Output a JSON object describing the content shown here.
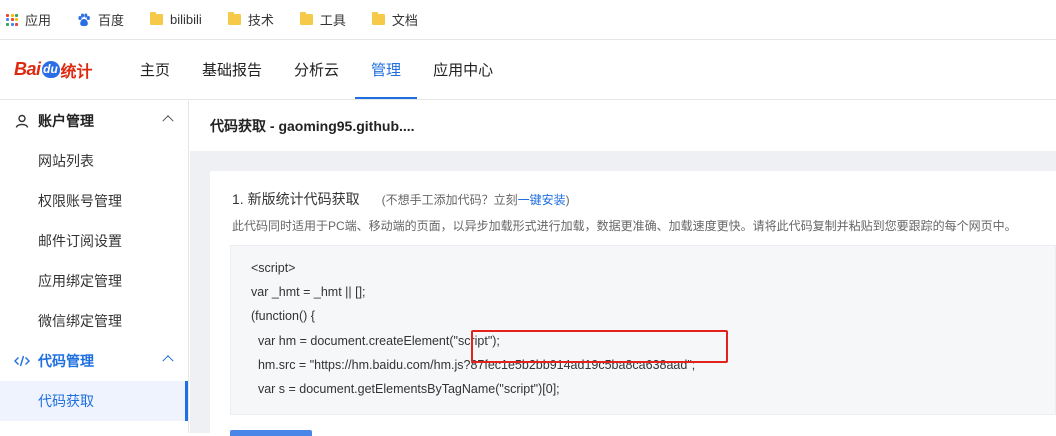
{
  "bookmarks": [
    {
      "label": "应用",
      "icon": "apps-grid-icon"
    },
    {
      "label": "百度",
      "icon": "baidu-paw-icon"
    },
    {
      "label": "bilibili",
      "icon": "folder-icon"
    },
    {
      "label": "技术",
      "icon": "folder-icon"
    },
    {
      "label": "工具",
      "icon": "folder-icon"
    },
    {
      "label": "文档",
      "icon": "folder-icon"
    }
  ],
  "logo": {
    "bai": "Bai",
    "du": "du",
    "tongji": "统计"
  },
  "nav": {
    "items": [
      {
        "label": "主页",
        "active": false
      },
      {
        "label": "基础报告",
        "active": false
      },
      {
        "label": "分析云",
        "active": false
      },
      {
        "label": "管理",
        "active": true
      },
      {
        "label": "应用中心",
        "active": false
      }
    ]
  },
  "sidebar": {
    "group1": {
      "label": "账户管理",
      "icon": "user-icon"
    },
    "group1_items": [
      "网站列表",
      "权限账号管理",
      "邮件订阅设置",
      "应用绑定管理",
      "微信绑定管理"
    ],
    "group2": {
      "label": "代码管理",
      "icon": "code-icon"
    },
    "group2_items": [
      "代码获取"
    ]
  },
  "main": {
    "header": "代码获取 - gaoming95.github....",
    "section_title": "1. 新版统计代码获取",
    "hint_prefix": "(不想手工添加代码？立刻",
    "hint_link": "一键安装",
    "hint_suffix": ")",
    "description": "此代码同时适用于PC端、移动端的页面，以异步加载形式进行加载，数据更准确、加载速度更快。请将此代码复制并粘贴到您要跟踪的每个网页中。",
    "code_lines": [
      "<script>",
      "var _hmt = _hmt || [];",
      "(function() {",
      "  var hm = document.createElement(\"script\");",
      "  hm.src = \"https://hm.baidu.com/hm.js?87fec1e5b2bb914ad19c5ba8ca638aad\";",
      "  var s = document.getElementsByTagName(\"script\")[0];"
    ]
  },
  "colors": {
    "accent": "#1f6fe0",
    "highlight": "#e3211d",
    "logo_red": "#de2910"
  }
}
